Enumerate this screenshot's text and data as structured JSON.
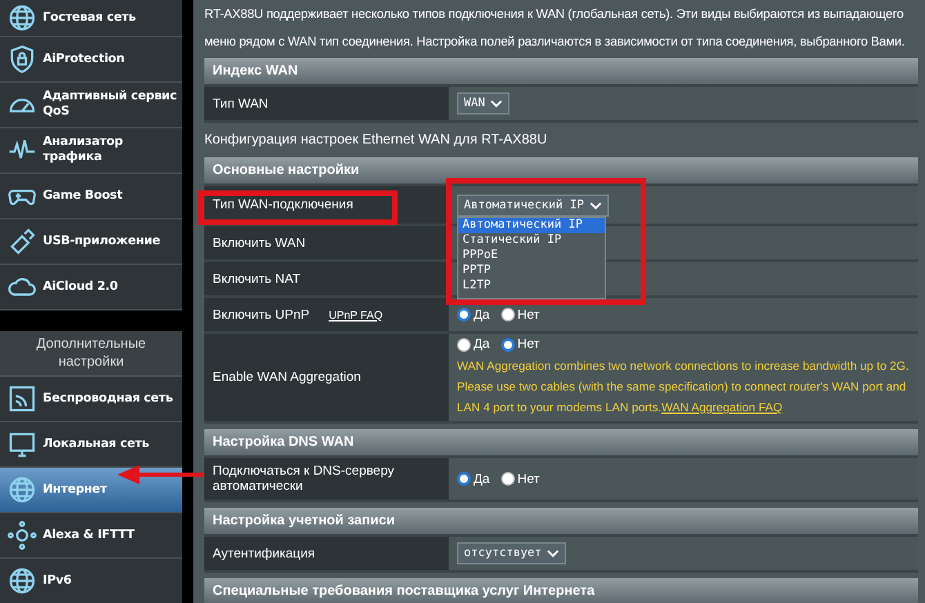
{
  "sidebar": {
    "items": [
      {
        "label": "Гостевая сеть",
        "selected": false
      },
      {
        "label": "AiProtection",
        "selected": false
      },
      {
        "label": "Адаптивный сервис QoS",
        "selected": false
      },
      {
        "label": "Анализатор трафика",
        "selected": false
      },
      {
        "label": "Game Boost",
        "selected": false
      },
      {
        "label": "USB-приложение",
        "selected": false
      },
      {
        "label": "AiCloud 2.0",
        "selected": false
      }
    ],
    "section_title": "Дополнительные настройки",
    "advanced_items": [
      {
        "label": "Беспроводная сеть",
        "selected": false
      },
      {
        "label": "Локальная сеть",
        "selected": false
      },
      {
        "label": "Интернет",
        "selected": true
      },
      {
        "label": "Alexa & IFTTT",
        "selected": false
      },
      {
        "label": "IPv6",
        "selected": false
      }
    ]
  },
  "main": {
    "intro": "RT-AX88U поддерживает несколько типов подключения к WAN (глобальная сеть). Эти виды выбираются из выпадающего меню рядом с WAN тип соединения. Настройка полей различаются в зависимости от типа соединения, выбранного Вами.",
    "blocks": [
      {
        "kind": "section",
        "title": "Индекс WAN",
        "rows": [
          {
            "label": "Тип WAN",
            "kind": "select",
            "value": "WAN"
          }
        ]
      },
      {
        "kind": "note",
        "text": "Конфигурация настроек Ethernet WAN для RT-AX88U"
      },
      {
        "kind": "section",
        "title": "Основные настройки",
        "rows": [
          {
            "label": "Тип WAN-подключения",
            "kind": "select",
            "value": "Автоматический IP",
            "open": true,
            "highlighted": true,
            "options": [
              {
                "label": "Автоматический IP",
                "selected": true
              },
              {
                "label": "Статический IP",
                "selected": false
              },
              {
                "label": "PPPoE",
                "selected": false
              },
              {
                "label": "PPTP",
                "selected": false
              },
              {
                "label": "L2TP",
                "selected": false
              }
            ]
          },
          {
            "label": "Включить WAN",
            "kind": "blank"
          },
          {
            "label": "Включить NAT",
            "kind": "blank"
          },
          {
            "label": "Включить UPnP",
            "link": "UPnP  FAQ",
            "kind": "radio",
            "options": [
              {
                "label": "Да",
                "selected": true
              },
              {
                "label": "Нет",
                "selected": false
              }
            ]
          },
          {
            "label": "Enable WAN Aggregation",
            "kind": "radio",
            "options": [
              {
                "label": "Да",
                "selected": false
              },
              {
                "label": "Нет",
                "selected": true
              }
            ],
            "note": "WAN Aggregation combines two network connections to increase bandwidth up to 2G. Please use two cables (with the same specification) to connect router's WAN port and LAN 4 port to your modems LAN ports.",
            "note_link": "WAN Aggregation FAQ"
          }
        ]
      },
      {
        "kind": "section",
        "title": "Настройка DNS WAN",
        "rows": [
          {
            "label": "Подключаться к DNS-серверу автоматически",
            "kind": "radio",
            "options": [
              {
                "label": "Да",
                "selected": true
              },
              {
                "label": "Нет",
                "selected": false
              }
            ]
          }
        ]
      },
      {
        "kind": "section",
        "title": "Настройка учетной записи",
        "rows": [
          {
            "label": "Аутентификация",
            "kind": "select",
            "value": "отсутствует"
          }
        ]
      },
      {
        "kind": "section",
        "title": "Специальные требования поставщика услуг Интернета"
      }
    ]
  }
}
